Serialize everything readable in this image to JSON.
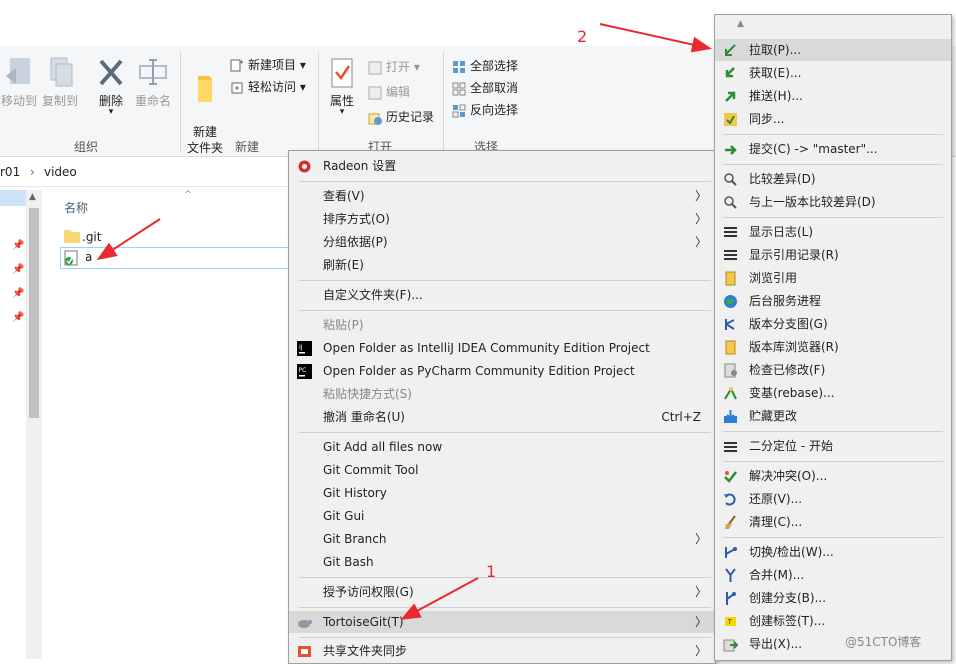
{
  "ribbon": {
    "move_to": "移动到",
    "copy_to": "复制到",
    "delete": "删除",
    "rename": "重命名",
    "new_folder": "新建\n文件夹",
    "new_item": "新建项目",
    "easy_access": "轻松访问",
    "properties": "属性",
    "open": "打开",
    "edit": "编辑",
    "history": "历史记录",
    "select_all": "全部选择",
    "select_none": "全部取消",
    "invert_select": "反向选择",
    "group_organize": "组织",
    "group_new": "新建",
    "group_open": "打开",
    "group_select": "选择"
  },
  "address": {
    "part1": "r01",
    "separator": "›",
    "part2": "video"
  },
  "file_list": {
    "column_name": "名称",
    "items": [
      ".git",
      "a"
    ]
  },
  "context_menu": {
    "radeon": "Radeon 设置",
    "view": "查看(V)",
    "sort": "排序方式(O)",
    "group": "分组依据(P)",
    "refresh": "刷新(E)",
    "customize": "自定义文件夹(F)...",
    "paste": "粘贴(P)",
    "intellij": "Open Folder as IntelliJ IDEA Community Edition Project",
    "pycharm": "Open Folder as PyCharm Community Edition Project",
    "paste_shortcut": "粘贴快捷方式(S)",
    "undo_rename": "撤消 重命名(U)",
    "undo_shortcut": "Ctrl+Z",
    "git_add_all": "Git Add all files now",
    "git_commit_tool": "Git Commit Tool",
    "git_history": "Git History",
    "git_gui": "Git Gui",
    "git_branch": "Git Branch",
    "git_bash": "Git Bash",
    "grant_access": "授予访问权限(G)",
    "tortoisegit": "TortoiseGit(T)",
    "share_sync": "共享文件夹同步"
  },
  "submenu": {
    "pull": "拉取(P)...",
    "fetch": "获取(E)...",
    "push": "推送(H)...",
    "sync": "同步...",
    "commit": "提交(C) -> \"master\"...",
    "diff": "比较差异(D)",
    "diff_prev": "与上一版本比较差异(D)",
    "show_log": "显示日志(L)",
    "show_reflog": "显示引用记录(R)",
    "browse_refs": "浏览引用",
    "daemon": "后台服务进程",
    "revision_graph": "版本分支图(G)",
    "repo_browser": "版本库浏览器(R)",
    "check_mods": "检查已修改(F)",
    "rebase": "变基(rebase)...",
    "stash": "贮藏更改",
    "bisect": "二分定位 - 开始",
    "resolve": "解决冲突(O)...",
    "revert": "还原(V)...",
    "cleanup": "清理(C)...",
    "switch": "切换/检出(W)...",
    "merge": "合并(M)...",
    "create_branch": "创建分支(B)...",
    "create_tag": "创建标签(T)...",
    "export": "导出(X)..."
  },
  "annotations": {
    "label1": "1",
    "label2": "2"
  },
  "watermark": "@51CTO博客",
  "colors": {
    "arrow_red": "#e8292f",
    "highlight": "#d9d9d9",
    "menu_bg": "#f0f0f0"
  }
}
